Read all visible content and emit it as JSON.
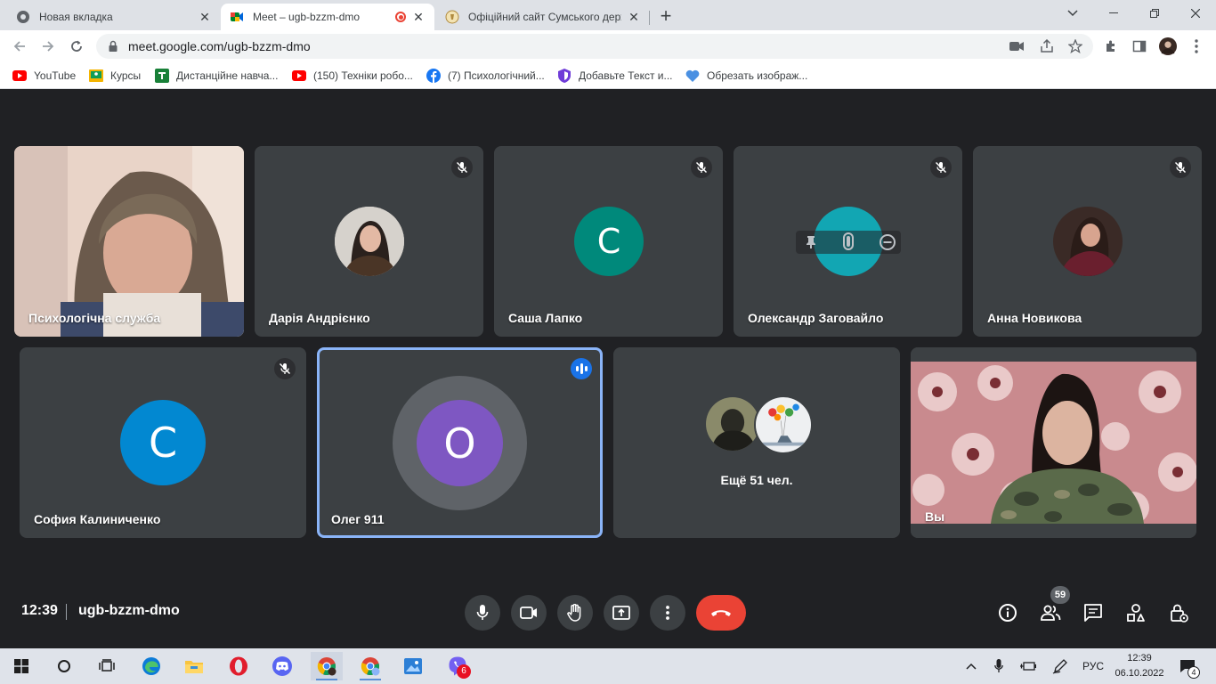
{
  "browser": {
    "tabs": [
      {
        "title": "Новая вкладка"
      },
      {
        "title": "Meet – ugb-bzzm-dmo"
      },
      {
        "title": "Офіційний сайт Сумського держ"
      }
    ],
    "url": "meet.google.com/ugb-bzzm-dmo",
    "bookmarks": [
      {
        "label": "YouTube",
        "icon": "youtube-icon"
      },
      {
        "label": "Курсы",
        "icon": "classroom-icon"
      },
      {
        "label": "Дистанційне навча...",
        "icon": "classroom-green-icon"
      },
      {
        "label": "(150) Техніки робо...",
        "icon": "youtube-icon"
      },
      {
        "label": "(7) Психологічний...",
        "icon": "facebook-icon"
      },
      {
        "label": "Добавьте Текст и...",
        "icon": "shield-icon"
      },
      {
        "label": "Обрезать изображ...",
        "icon": "heart-icon"
      }
    ]
  },
  "meet": {
    "participants": [
      {
        "name": "Психологічна служба"
      },
      {
        "name": "Дарія Андрієнко"
      },
      {
        "name": "Саша Лапко",
        "initial": "С"
      },
      {
        "name": "Олександр Заговайло"
      },
      {
        "name": "Анна Новикова"
      },
      {
        "name": "София Калиниченко",
        "initial": "С"
      },
      {
        "name": "Олег 911",
        "initial": "O"
      },
      {
        "name": "Вы"
      }
    ],
    "more_label": "Ещё 51 чел.",
    "time": "12:39",
    "meeting_code": "ugb-bzzm-dmo",
    "people_count": "59",
    "colors": {
      "avatar_teal": "#00897b",
      "avatar_blue": "#0288d1",
      "avatar_purple": "#7e57c2",
      "end_call": "#ea4335",
      "speaking_outline": "#8ab4f8"
    }
  },
  "taskbar": {
    "language": "РУС",
    "time": "12:39",
    "date": "06.10.2022",
    "viber_badge": "6",
    "notifications": "4"
  }
}
